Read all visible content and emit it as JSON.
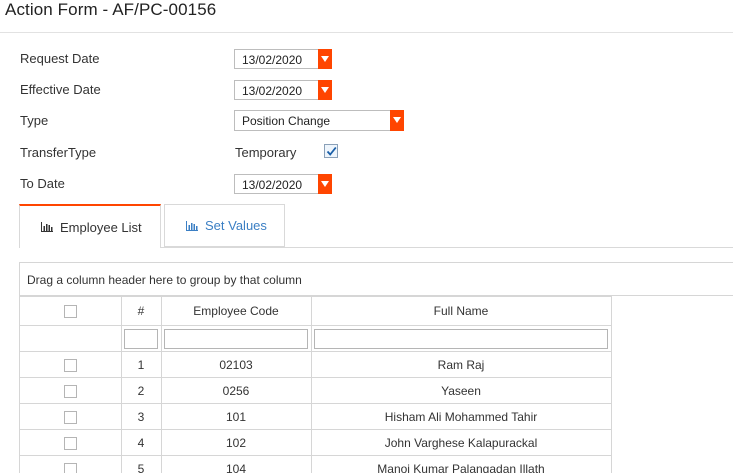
{
  "page": {
    "title": "Action Form - AF/PC-00156"
  },
  "form": {
    "request_date_label": "Request Date",
    "request_date_value": "13/02/2020",
    "effective_date_label": "Effective Date",
    "effective_date_value": "13/02/2020",
    "type_label": "Type",
    "type_value": "Position Change",
    "transfer_type_label": "TransferType",
    "transfer_type_option": "Temporary",
    "transfer_type_checked": true,
    "to_date_label": "To Date",
    "to_date_value": "13/02/2020"
  },
  "tabs": [
    {
      "label": "Employee List",
      "icon": "bar-chart-icon",
      "active": true
    },
    {
      "label": "Set Values",
      "icon": "bar-chart-icon",
      "active": false
    }
  ],
  "grid": {
    "group_hint": "Drag a column header here to group by that column",
    "columns": [
      "",
      "#",
      "Employee Code",
      "Full Name"
    ],
    "rows": [
      {
        "num": "1",
        "code": "02103",
        "name": "Ram Raj"
      },
      {
        "num": "2",
        "code": "0256",
        "name": "Yaseen"
      },
      {
        "num": "3",
        "code": "101",
        "name": "Hisham Ali Mohammed Tahir"
      },
      {
        "num": "4",
        "code": "102",
        "name": "John Varghese Kalapurackal"
      },
      {
        "num": "5",
        "code": "104",
        "name": "Manoj Kumar Palangadan Illath"
      }
    ]
  },
  "colors": {
    "accent": "#ff4500",
    "link": "#3b7fc4",
    "border": "#d6d6d6"
  }
}
